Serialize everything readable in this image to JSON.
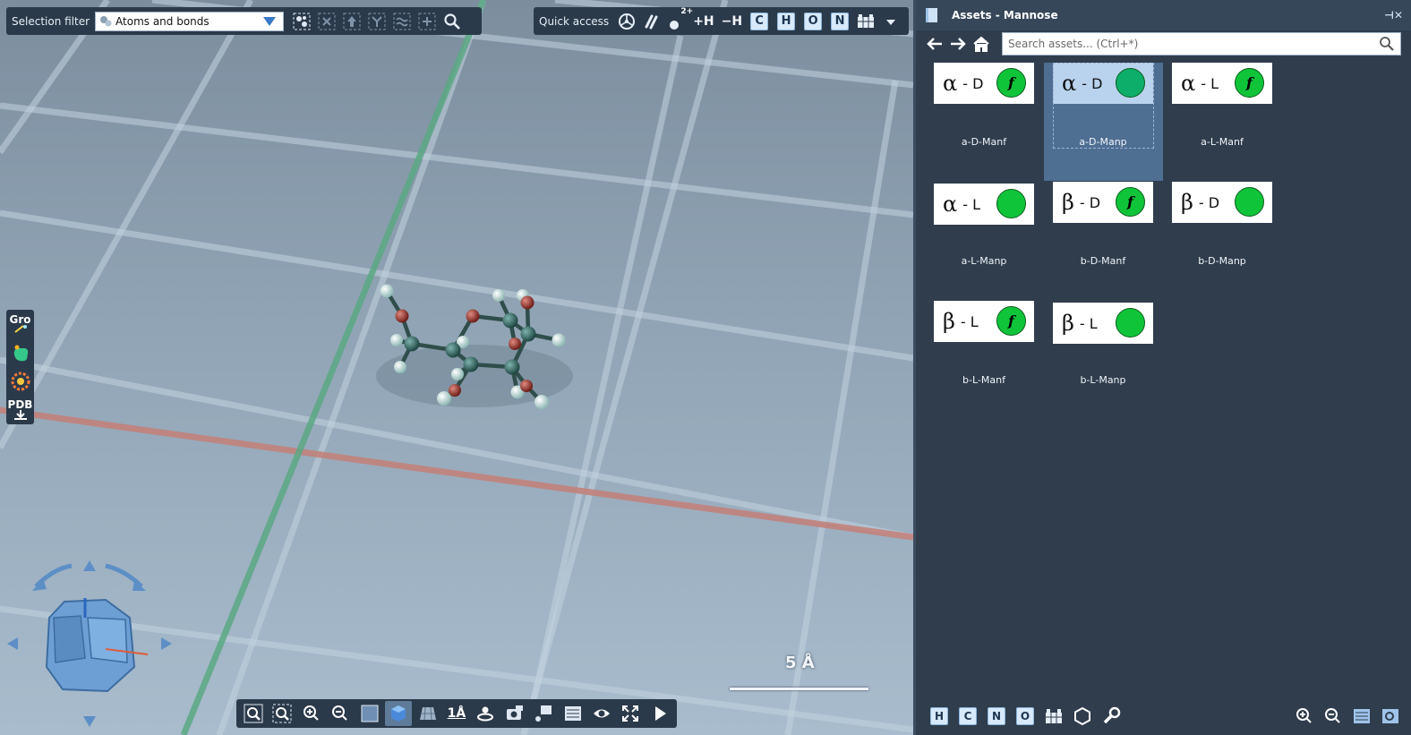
{
  "selection_toolbar": {
    "label": "Selection filter",
    "dropdown_value": "Atoms and bonds",
    "icons": [
      "select-atoms-icon",
      "deselect-icon",
      "select-up-icon",
      "select-network-icon",
      "select-similar-icon",
      "add-selection-icon",
      "search-icon"
    ]
  },
  "quick_access": {
    "label": "Quick access",
    "add_h": "+H",
    "remove_h": "−H",
    "charge": "2+",
    "elements": [
      "C",
      "H",
      "O",
      "N"
    ]
  },
  "left_tools": {
    "gro_label": "Gro",
    "pdb_label": "PDB"
  },
  "scale": {
    "label": "5 Å"
  },
  "bottom_toolbar": {
    "measure_label": "1Å"
  },
  "panel": {
    "title": "Assets - Mannose",
    "search_placeholder": "Search assets... (Ctrl+*)",
    "assets": [
      {
        "greek": "α",
        "cfg": "- D",
        "furanose": true,
        "name": "a-D-Manf",
        "selected": false
      },
      {
        "greek": "α",
        "cfg": "- D",
        "furanose": false,
        "name": "a-D-Manp",
        "selected": true
      },
      {
        "greek": "α",
        "cfg": "- L",
        "furanose": true,
        "name": "a-L-Manf",
        "selected": false
      },
      {
        "greek": "α",
        "cfg": "- L",
        "furanose": false,
        "name": "a-L-Manp",
        "selected": false
      },
      {
        "greek": "β",
        "cfg": "- D",
        "furanose": true,
        "name": "b-D-Manf",
        "selected": false
      },
      {
        "greek": "β",
        "cfg": "- D",
        "furanose": false,
        "name": "b-D-Manp",
        "selected": false
      },
      {
        "greek": "β",
        "cfg": "- L",
        "furanose": true,
        "name": "b-L-Manf",
        "selected": false
      },
      {
        "greek": "β",
        "cfg": "- L",
        "furanose": false,
        "name": "b-L-Manp",
        "selected": false
      }
    ],
    "furanose_mark": "f",
    "bottom_elements": [
      "H",
      "C",
      "N",
      "O"
    ]
  },
  "colors": {
    "carbon": "#2f5e5a",
    "oxygen": "#9a3a32",
    "hydrogen": "#d6f0ee",
    "x_axis": "#c47f77",
    "y_axis": "#5aa882",
    "ring_green": "#10c43a",
    "accent": "#3878c8"
  }
}
